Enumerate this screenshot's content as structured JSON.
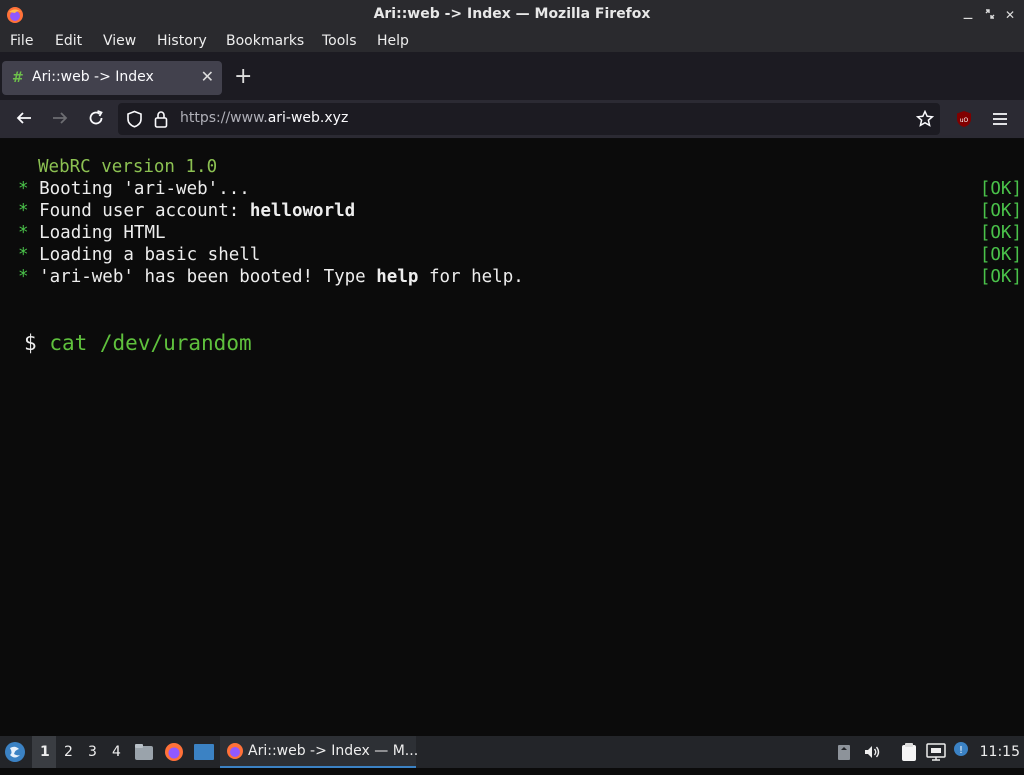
{
  "window": {
    "title": "Ari::web -> Index — Mozilla Firefox",
    "controls": [
      "minimize",
      "maximize",
      "close"
    ]
  },
  "menu": {
    "items": [
      {
        "label": "File"
      },
      {
        "label": "Edit"
      },
      {
        "label": "View"
      },
      {
        "label": "History"
      },
      {
        "label": "Bookmarks"
      },
      {
        "label": "Tools"
      },
      {
        "label": "Help"
      }
    ]
  },
  "tabs": [
    {
      "title": "Ari::web -> Index",
      "favicon": "hash-favicon",
      "active": true
    }
  ],
  "urlbar": {
    "url_prefix": "https://www.",
    "url_domain": "ari-web.xyz"
  },
  "terminal": {
    "header": "WebRC version 1.0",
    "ok_label": "[OK]",
    "bullet": "*",
    "boot_lines": [
      {
        "text": "Booting 'ari-web'..."
      },
      {
        "text_before": "Found user account: ",
        "bold": "helloworld",
        "text_after": ""
      },
      {
        "text": "Loading HTML"
      },
      {
        "text": "Loading a basic shell"
      },
      {
        "text_before": "'ari-web' has been booted! Type ",
        "bold": "help",
        "text_after": " for help."
      }
    ],
    "prompt_symbol": "$",
    "command": "cat /dev/urandom"
  },
  "taskbar": {
    "workspaces": [
      "1",
      "2",
      "3",
      "4"
    ],
    "active_workspace": "1",
    "window_button": "Ari::web -> Index — M...",
    "clock": "11:15"
  },
  "colors": {
    "terminal_green": "#4ac24a",
    "page_background": "#0b0b0b",
    "chrome_dark": "#2a2a2e"
  }
}
